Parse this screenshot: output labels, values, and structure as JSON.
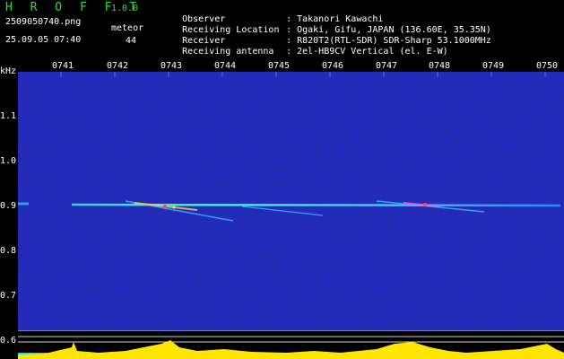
{
  "header": {
    "app_name": "H R O F F T",
    "version": "1.0.0",
    "filename": "2509050740.png",
    "datetime": "25.09.05 07:40",
    "meteor_label": "meteor",
    "meteor_count": "44",
    "info": [
      {
        "key": "Observer",
        "value": "Takanori Kawachi"
      },
      {
        "key": "Receiving Location",
        "value": "Ogaki, Gifu, JAPAN (136.60E, 35.35N)"
      },
      {
        "key": "Receiver",
        "value": "R820T2(RTL-SDR) SDR-Sharp 53.1000MHz"
      },
      {
        "key": "Receiving antenna",
        "value": "2el-HB9CV Vertical (el. E-W)"
      }
    ]
  },
  "axis": {
    "unit": "kHz",
    "time_ticks": [
      "0741",
      "0742",
      "0743",
      "0744",
      "0745",
      "0746",
      "0747",
      "0748",
      "0749",
      "0750"
    ],
    "freq_ticks": [
      "1.1",
      "1.0",
      "0.9",
      "0.8",
      "0.7",
      "0.6"
    ]
  },
  "colors": {
    "background": "#000000",
    "noise": "#0a0a6e",
    "title": "#33dd33",
    "text": "#ffffff",
    "level_fill": "#ffe600",
    "level_base": "#00e5ff"
  }
}
